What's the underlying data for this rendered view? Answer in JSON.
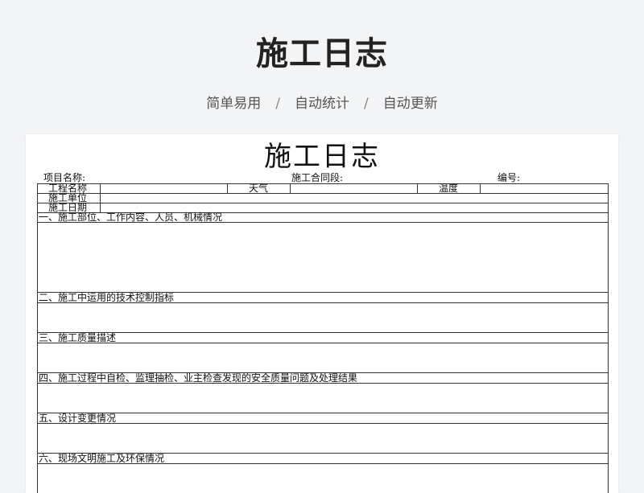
{
  "header": {
    "title": "施工日志",
    "taglines": [
      "简单易用",
      "自动统计",
      "自动更新"
    ],
    "separator": "/"
  },
  "document": {
    "title": "施工日志",
    "project_name_label": "项目名称:",
    "contract_section_label": "施工合同段:",
    "code_label": "编号:",
    "rows": {
      "project_name": "工程名称",
      "weather": "天气",
      "temperature": "温度",
      "construction_unit": "施工单位",
      "construction_date": "施工日期"
    },
    "sections": [
      "一、施工部位、工作内容、人员、机械情况",
      "二、施工中运用的技术控制指标",
      "三、施工质量描述",
      "四、施工过程中自检、监理抽检、业主检查发现的安全质量问题及处理结果",
      "五、设计变更情况",
      "六、现场文明施工及环保情况"
    ]
  }
}
